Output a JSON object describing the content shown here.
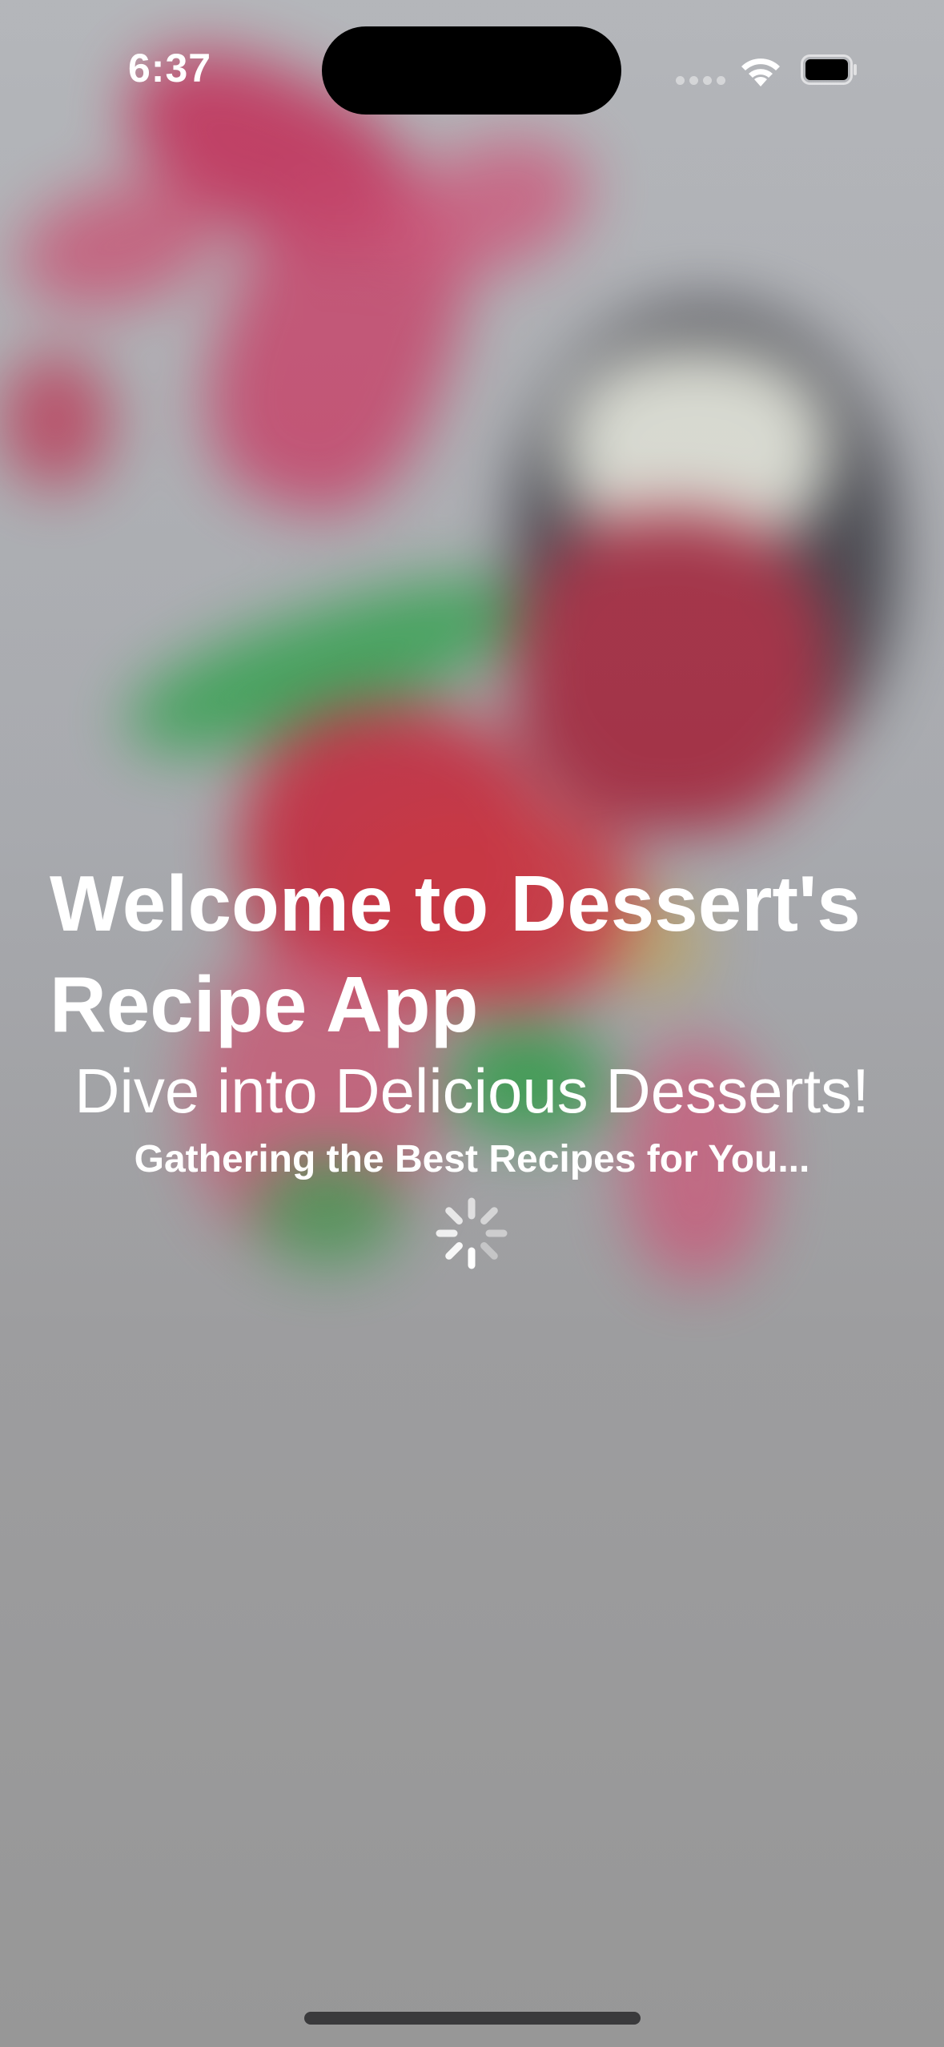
{
  "status_bar": {
    "time": "6:37",
    "icons": [
      "cellular-signal-icon",
      "wifi-icon",
      "battery-icon"
    ]
  },
  "splash": {
    "title": "Welcome to Dessert's Recipe App",
    "tagline": "Dive into Delicious Desserts!",
    "loading_message": "Gathering the Best Recipes for You...",
    "loading_indicator": "spinner-icon"
  },
  "colors": {
    "text": "#ffffff",
    "accent_red": "#c8194a",
    "accent_green": "#2ca24a"
  }
}
